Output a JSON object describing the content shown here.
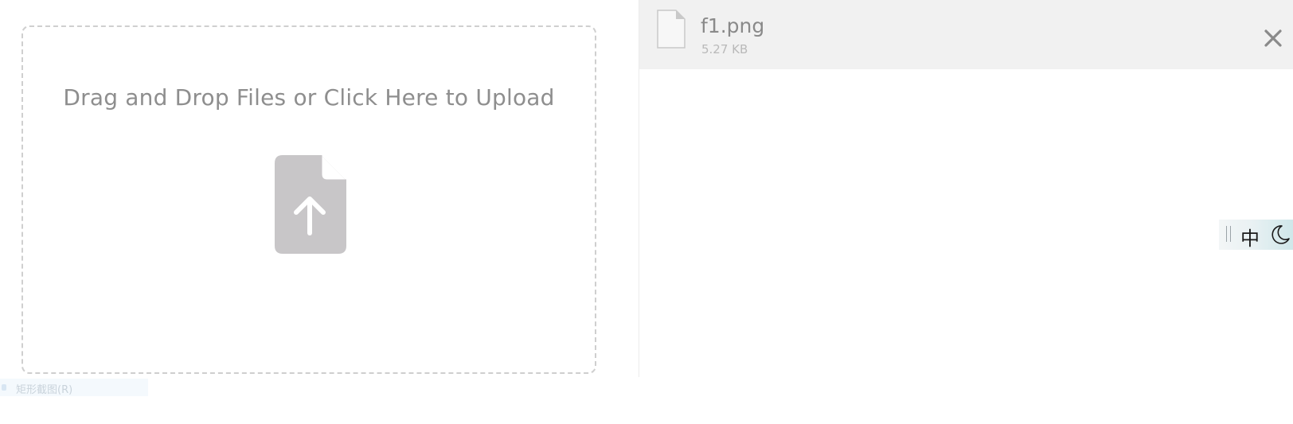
{
  "dropzone": {
    "prompt": "Drag and Drop Files or Click Here to Upload",
    "icon": "file-upload-icon"
  },
  "files": [
    {
      "name": "f1.png",
      "size": "5.27 KB",
      "icon": "file-icon",
      "remove_icon": "close-icon"
    }
  ],
  "ime_toolbar": {
    "language": "中",
    "mode_icon": "moon-icon",
    "handle_icon": "drag-handle-icon"
  },
  "ghost_tooltip": {
    "text": "矩形截图(R)"
  },
  "colors": {
    "dropzone_border": "#cfcfcf",
    "prompt_text": "#8e8e8e",
    "upload_icon_fill": "#c8c6c8",
    "file_row_bg": "#f1f1f1",
    "file_name": "#8a8a8a",
    "file_size": "#b9b9b9"
  }
}
